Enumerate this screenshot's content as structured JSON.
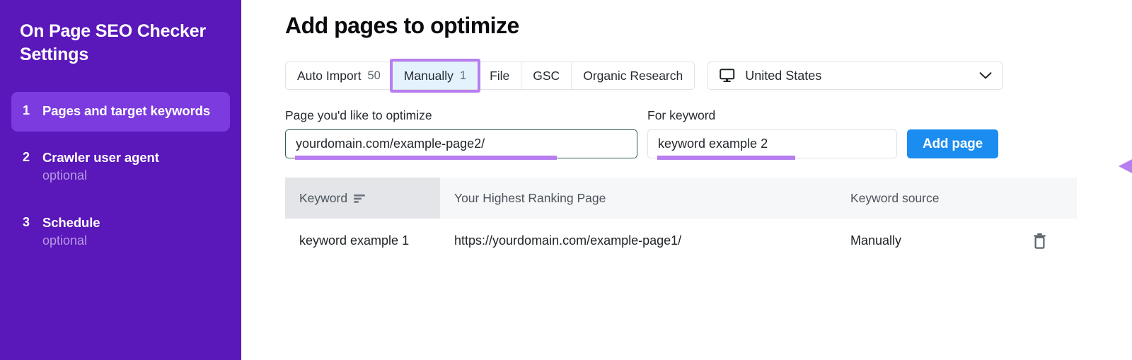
{
  "sidebar": {
    "title": "On Page SEO Checker Settings",
    "items": [
      {
        "num": "1",
        "label": "Pages and target keywords",
        "sub": "",
        "active": true
      },
      {
        "num": "2",
        "label": "Crawler user agent",
        "sub": "optional",
        "active": false
      },
      {
        "num": "3",
        "label": "Schedule",
        "sub": "optional",
        "active": false
      }
    ]
  },
  "main": {
    "title": "Add pages to optimize"
  },
  "tabs": [
    {
      "label": "Auto Import",
      "count": "50",
      "selected": false
    },
    {
      "label": "Manually",
      "count": "1",
      "selected": true
    },
    {
      "label": "File",
      "count": "",
      "selected": false
    },
    {
      "label": "GSC",
      "count": "",
      "selected": false
    },
    {
      "label": "Organic Research",
      "count": "",
      "selected": false
    }
  ],
  "country": {
    "value": "United States",
    "icon": "monitor-icon",
    "chevron": "chevron-down-icon"
  },
  "form": {
    "page_label": "Page you'd like to optimize",
    "keyword_label": "For keyword",
    "page_value": "yourdomain.com/example-page2/",
    "page_placeholder": "Enter page URL",
    "keyword_value": "keyword example 2",
    "keyword_placeholder": "Enter keyword",
    "add_button": "Add page"
  },
  "table": {
    "columns": [
      "Keyword",
      "Your Highest Ranking Page",
      "Keyword source",
      ""
    ],
    "sorted_column": "Keyword",
    "rows": [
      {
        "keyword": "keyword example 1",
        "page": "https://yourdomain.com/example-page1/",
        "source": "Manually",
        "action": "delete-icon"
      }
    ]
  },
  "colors": {
    "sidebar_bg": "#5a17ba",
    "sidebar_active": "#7c3bde",
    "accent_blue": "#1b8cf0",
    "annotation_purple": "#b77ef0",
    "tab_selected_bg": "#e3f2fd",
    "focus_border": "#2d5f52"
  }
}
